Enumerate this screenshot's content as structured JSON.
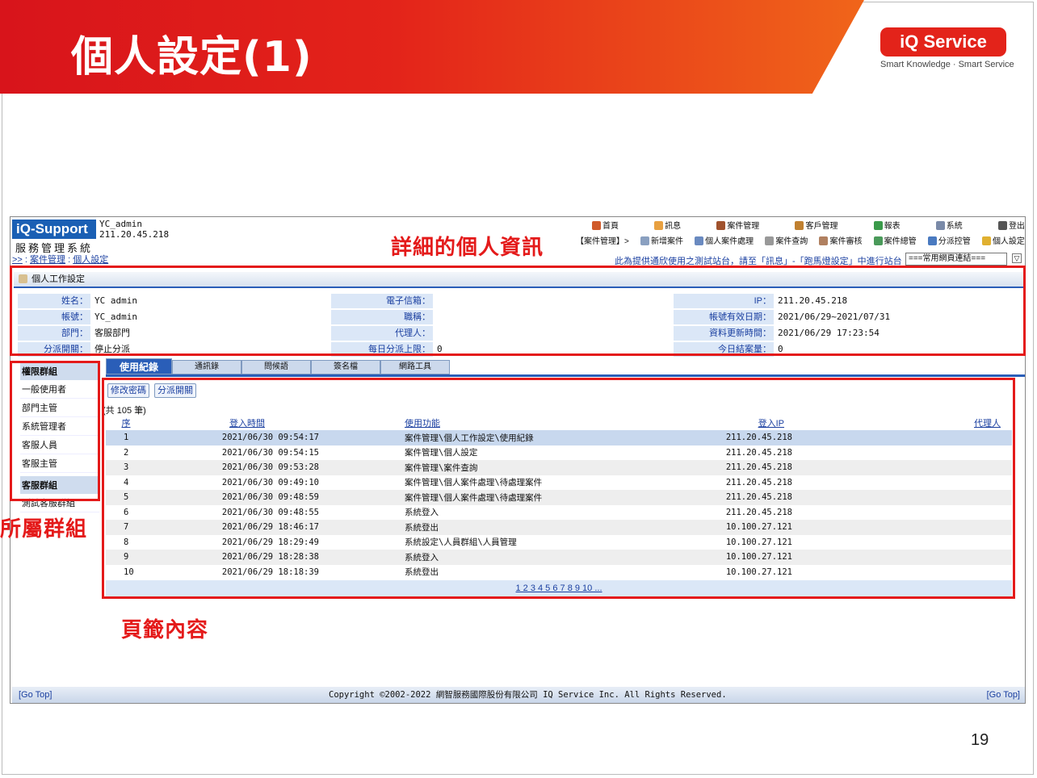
{
  "slide": {
    "title": "個人設定(1)",
    "logo": "iQ Service",
    "tagline": "Smart Knowledge · Smart Service",
    "page_number": "19"
  },
  "app": {
    "logo": "iQ-Support",
    "user_name": "YC_admin",
    "user_ip": "211.20.45.218",
    "subtitle": "服務管理系統",
    "breadcrumb_arrow": ">>",
    "breadcrumb_section": "案件管理",
    "breadcrumb_page": "個人設定",
    "top_nav": [
      "首頁",
      "訊息",
      "案件管理",
      "客戶管理",
      "報表",
      "系統",
      "登出"
    ],
    "sub_nav": [
      "【案件管理】>",
      "新增案件",
      "個人案件處理",
      "案件查詢",
      "案件審核",
      "案件總管",
      "分派控管",
      "個人設定"
    ],
    "notice": "此為提供通欣使用之測試站台，請至「訊息」-「跑馬燈設定」中進行站台",
    "links_select": "===常用網頁連結===",
    "accent_color": "#2a5eb8"
  },
  "panel": {
    "title": "個人工作設定",
    "rows": [
      [
        {
          "label": "姓名：",
          "value": "YC admin"
        },
        {
          "label": "電子信箱：",
          "value": ""
        },
        {
          "label": "IP：",
          "value": "211.20.45.218"
        }
      ],
      [
        {
          "label": "帳號：",
          "value": "YC_admin"
        },
        {
          "label": "職稱：",
          "value": ""
        },
        {
          "label": "帳號有效日期：",
          "value": "2021/06/29~2021/07/31"
        }
      ],
      [
        {
          "label": "部門：",
          "value": "客服部門"
        },
        {
          "label": "代理人：",
          "value": ""
        },
        {
          "label": "資料更新時間：",
          "value": "2021/06/29 17:23:54"
        }
      ],
      [
        {
          "label": "分派開關：",
          "value": "停止分派"
        },
        {
          "label": "每日分派上限：",
          "value": "0"
        },
        {
          "label": "今日結案量：",
          "value": "0"
        }
      ]
    ]
  },
  "sidebar": {
    "group1_title": "權限群組",
    "group1_items": [
      "一般使用者",
      "部門主管",
      "系統管理者",
      "客服人員",
      "客服主管"
    ],
    "group2_title": "客服群組",
    "group2_items": [
      "測試客服群組"
    ]
  },
  "tabs": [
    "使用紀錄",
    "通訊錄",
    "問候語",
    "簽名檔",
    "網路工具"
  ],
  "buttons": {
    "change_password": "修改密碼",
    "dispatch_switch": "分派開關"
  },
  "record_count": "(共 105 筆)",
  "table": {
    "headers": [
      "序",
      "登入時間",
      "使用功能",
      "登入IP",
      "代理人"
    ],
    "rows": [
      [
        "1",
        "2021/06/30 09:54:17",
        "案件管理\\個人工作設定\\使用紀錄",
        "211.20.45.218",
        ""
      ],
      [
        "2",
        "2021/06/30 09:54:15",
        "案件管理\\個人設定",
        "211.20.45.218",
        ""
      ],
      [
        "3",
        "2021/06/30 09:53:28",
        "案件管理\\案件查詢",
        "211.20.45.218",
        ""
      ],
      [
        "4",
        "2021/06/30 09:49:10",
        "案件管理\\個人案件處理\\待處理案件",
        "211.20.45.218",
        ""
      ],
      [
        "5",
        "2021/06/30 09:48:59",
        "案件管理\\個人案件處理\\待處理案件",
        "211.20.45.218",
        ""
      ],
      [
        "6",
        "2021/06/30 09:48:55",
        "系統登入",
        "211.20.45.218",
        ""
      ],
      [
        "7",
        "2021/06/29 18:46:17",
        "系統登出",
        "10.100.27.121",
        ""
      ],
      [
        "8",
        "2021/06/29 18:29:49",
        "系統設定\\人員群組\\人員管理",
        "10.100.27.121",
        ""
      ],
      [
        "9",
        "2021/06/29 18:28:38",
        "系統登入",
        "10.100.27.121",
        ""
      ],
      [
        "10",
        "2021/06/29 18:18:39",
        "系統登出",
        "10.100.27.121",
        ""
      ]
    ],
    "pager": "1 2 3 4 5 6 7 8 9 10 ..."
  },
  "footer": {
    "go_top": "[Go Top]",
    "copyright": "Copyright ©2002-2022 網智服務國際股份有限公司 IQ Service Inc. All Rights Reserved."
  },
  "annotations": {
    "detail_info": "詳細的個人資訊",
    "groups": "所屬群組",
    "tab_content": "頁籤內容",
    "color": "#e41a1a"
  }
}
